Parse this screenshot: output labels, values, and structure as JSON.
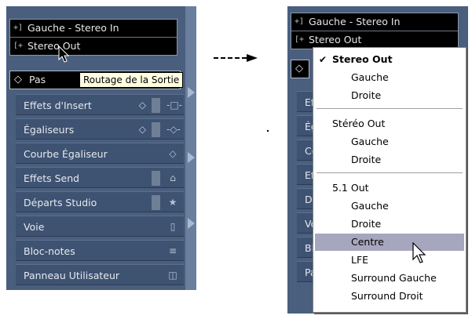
{
  "left_panel": {
    "routing": {
      "input_label": "Gauche - Stereo In",
      "output_label": "Stereo Out",
      "input_icon": "input-routing-icon",
      "output_icon": "output-routing-icon"
    },
    "pass_label": "Pas",
    "tooltip": "Routage de la Sortie",
    "sections": [
      {
        "label": "Effets d'Insert",
        "icon": "insert-fx-icon"
      },
      {
        "label": "Égaliseurs",
        "icon": "eq-icon"
      },
      {
        "label": "Courbe Égaliseur",
        "icon": "eq-curve-icon"
      },
      {
        "label": "Effets Send",
        "icon": "send-icon"
      },
      {
        "label": "Départs Studio",
        "icon": "star-icon"
      },
      {
        "label": "Voie",
        "icon": "channel-icon"
      },
      {
        "label": "Bloc-notes",
        "icon": "notepad-icon"
      },
      {
        "label": "Panneau Utilisateur",
        "icon": "user-panel-icon"
      }
    ]
  },
  "right_panel": {
    "routing": {
      "input_label": "Gauche - Stereo In",
      "output_label": "Stereo Out"
    },
    "clipped_labels": [
      "Eff",
      "Ég",
      "Co",
      "Eff",
      "Dé",
      "Vo",
      "Blo",
      "Pa"
    ]
  },
  "dropdown": {
    "groups": [
      {
        "name": "Stereo Out",
        "checked": true,
        "bold": true,
        "items": [
          "Gauche",
          "Droite"
        ]
      },
      {
        "name": "Stéréo Out",
        "checked": false,
        "bold": false,
        "items": [
          "Gauche",
          "Droite"
        ]
      },
      {
        "name": "5.1 Out",
        "checked": false,
        "bold": false,
        "items": [
          "Gauche",
          "Droite",
          "Centre",
          "LFE",
          "Surround Gauche",
          "Surround Droit"
        ]
      }
    ],
    "highlighted": "Centre"
  },
  "colors": {
    "panel_bg": "#4a5f7e",
    "highlight": "#a7a6bf",
    "tooltip_bg": "#ffffe1"
  }
}
